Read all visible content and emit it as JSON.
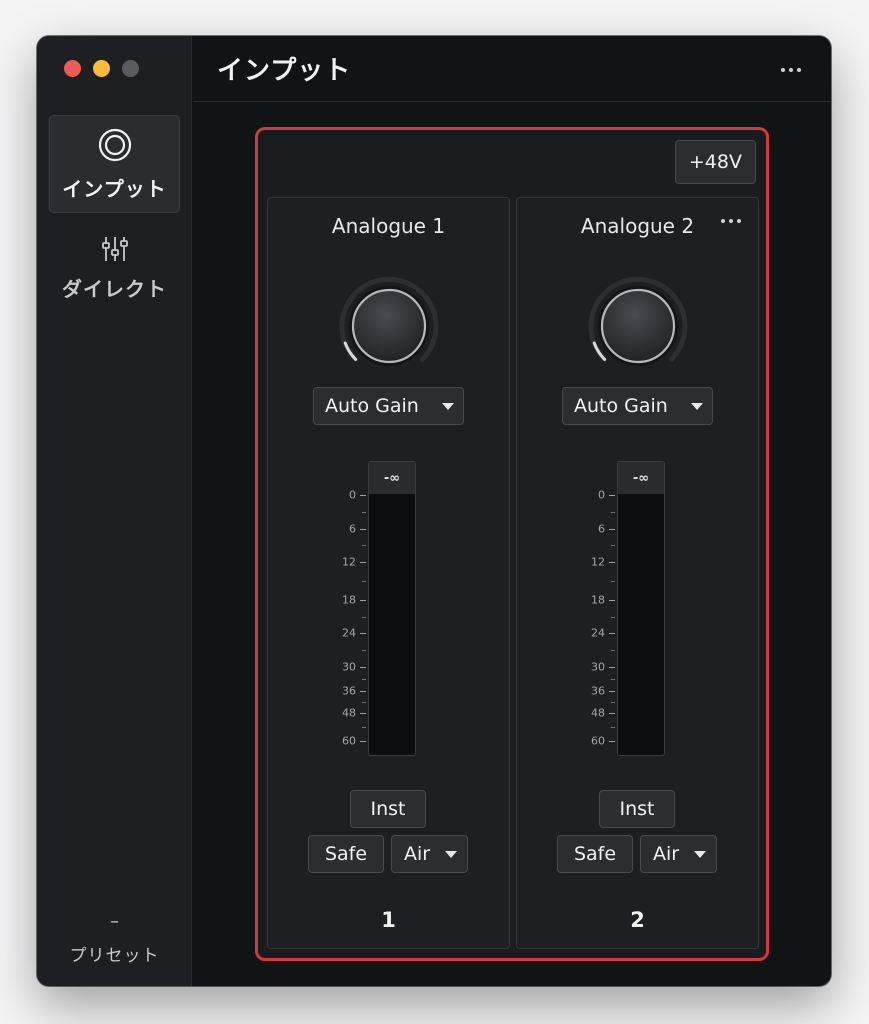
{
  "window": {
    "title": "インプット"
  },
  "sidebar": {
    "items": [
      {
        "label": "インプット",
        "icon": "input-rings-icon",
        "active": true
      },
      {
        "label": "ダイレクト",
        "icon": "sliders-icon",
        "active": false
      }
    ],
    "preset": {
      "value": "–",
      "label": "プリセット"
    }
  },
  "group": {
    "phantom_power_label": "+48V",
    "channels": [
      {
        "name": "Analogue 1",
        "gain_mode": "Auto Gain",
        "knob_level": 0.1,
        "meter_peak": "-∞",
        "inst_label": "Inst",
        "safe_label": "Safe",
        "air_label": "Air",
        "number": "1"
      },
      {
        "name": "Analogue 2",
        "gain_mode": "Auto Gain",
        "knob_level": 0.1,
        "meter_peak": "-∞",
        "inst_label": "Inst",
        "safe_label": "Safe",
        "air_label": "Air",
        "number": "2"
      }
    ],
    "meter_scale": [
      "0",
      "6",
      "12",
      "18",
      "24",
      "30",
      "36",
      "48",
      "60"
    ]
  },
  "colors": {
    "accent_red": "#d13a3e",
    "background": "#121315",
    "sidebar": "#1e1f22"
  }
}
